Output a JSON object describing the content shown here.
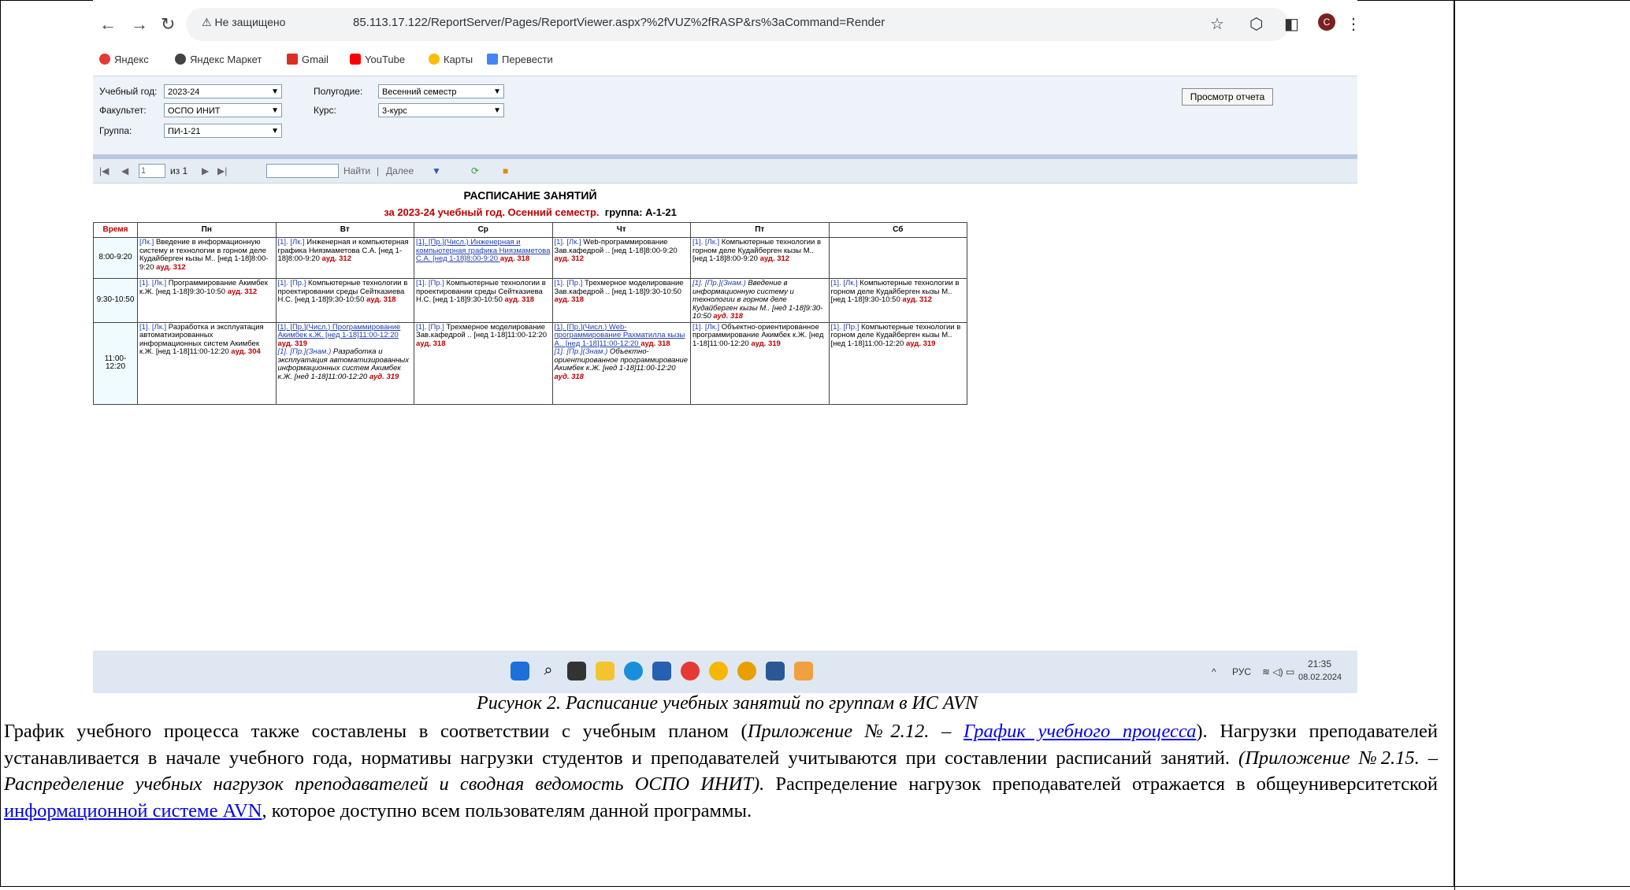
{
  "browser": {
    "security_label": "Не защищено",
    "url": "85.113.17.122/ReportServer/Pages/ReportViewer.aspx?%2fVUZ%2fRASP&rs%3aCommand=Render",
    "avatar_letter": "C",
    "bookmarks": [
      "Яндекс",
      "Яндекс Маркет",
      "Gmail",
      "YouTube",
      "Карты",
      "Перевести"
    ]
  },
  "params": {
    "year_label": "Учебный год:",
    "year_value": "2023-24",
    "faculty_label": "Факультет:",
    "faculty_value": "ОСПО ИНИТ",
    "group_label": "Группа:",
    "group_value": "ПИ-1-21",
    "semester_label": "Полугодие:",
    "semester_value": "Весенний семестр",
    "course_label": "Курс:",
    "course_value": "3-курс",
    "view_button": "Просмотр отчета"
  },
  "toolbar": {
    "page": "1",
    "of_pages": "из 1",
    "find": "Найти",
    "separator": "|",
    "next": "Далее"
  },
  "report": {
    "title": "РАСПИСАНИЕ ЗАНЯТИЙ",
    "subtitle": "за 2023-24 учебный год. Осенний семестр.",
    "group": "группа: А-1-21",
    "headers": [
      "Время",
      "Пн",
      "Вт",
      "Ср",
      "Чт",
      "Пт",
      "Сб"
    ],
    "rows": [
      {
        "time": "8:00-9:20",
        "cells": [
          [
            {
              "tag": "[Лк.]",
              "text": " Введение в информационную систему и технологии в горном деле Кудайберген кызы М.. [нед 1-18]8:00-9:20 ",
              "room": "ауд. 312"
            }
          ],
          [
            {
              "tag": "[1]. [Лк.]",
              "text": " Инженерная и компьютерная графика Ниязмаметова С.А. [нед 1-18]8:00-9:20 ",
              "room": "ауд. 312"
            }
          ],
          [
            {
              "tag": "[1]. [Пр.](Числ.)",
              "text": " Инженерная и компьютерная графика Ниязмаметова С.А. [нед 1-18]8:00-9:20 ",
              "room": "ауд. 318",
              "style": "ul"
            }
          ],
          [
            {
              "tag": "[1]. [Лк.]",
              "text": " Web-программирование Зав.кафедрой .. [нед 1-18]8:00-9:20 ",
              "room": "ауд. 312"
            }
          ],
          [
            {
              "tag": "[1]. [Лк.]",
              "text": " Компьютерные технологии в горном деле Кудайберген кызы М.. [нед 1-18]8:00-9:20 ",
              "room": "ауд. 312"
            }
          ],
          []
        ]
      },
      {
        "time": "9:30-10:50",
        "cells": [
          [
            {
              "tag": "[1]. [Лк.]",
              "text": " Программирование Акимбек к.Ж. [нед 1-18]9:30-10:50 ",
              "room": "ауд. 312"
            }
          ],
          [
            {
              "tag": "[1]. [Пр.]",
              "text": " Компьютерные технологии в проектировании среды Сейтказиева Н.С. [нед 1-18]9:30-10:50 ",
              "room": "ауд. 318"
            }
          ],
          [
            {
              "tag": "[1]. [Пр.]",
              "text": " Компьютерные технологии в проектировании среды Сейтказиева Н.С. [нед 1-18]9:30-10:50 ",
              "room": "ауд. 318"
            }
          ],
          [
            {
              "tag": "[1]. [Пр.]",
              "text": " Трехмерное моделирование Зав.кафедрой .. [нед 1-18]9:30-10:50 ",
              "room": "ауд. 318"
            }
          ],
          [
            {
              "tag": "[1]. [Пр.](Знам.)",
              "text": " Введение в информационную систему и технологии в горном деле Кудайберген кызы М.. [нед 1-18]9:30-10:50 ",
              "room": "ауд. 318",
              "style": "ital"
            }
          ],
          [
            {
              "tag": "[1]. [Лк.]",
              "text": " Компьютерные технологии в горном деле Кудайберген кызы М.. [нед 1-18]9:30-10:50 ",
              "room": "ауд. 312"
            }
          ]
        ]
      },
      {
        "time": "11:00-12:20",
        "cells": [
          [
            {
              "tag": "[1]. [Лк.]",
              "text": " Разработка и эксплуатация автоматизированных информационных систем Акимбек к.Ж. [нед 1-18]11:00-12:20 ",
              "room": "ауд. 304"
            }
          ],
          [
            {
              "tag": "[1]. [Пр.](Числ.)",
              "text": " Программирование Акимбек к.Ж. [нед 1-18]11:00-12:20 ",
              "room": "ауд. 319",
              "style": "ul"
            },
            {
              "tag": "[1]. [Пр.](Знам.)",
              "text": " Разработка и эксплуатация автоматизированных информационных систем Акимбек к.Ж. [нед 1-18]11:00-12:20 ",
              "room": "ауд. 319",
              "style": "ital"
            }
          ],
          [
            {
              "tag": "[1]. [Пр.]",
              "text": " Трехмерное моделирование Зав.кафедрой .. [нед 1-18]11:00-12:20 ",
              "room": "ауд. 318"
            }
          ],
          [
            {
              "tag": "[1]. [Пр.](Числ.)",
              "text": " Web-программирование Рахматилла кызы А.. [нед 1-18]11:00-12:20 ",
              "room": "ауд. 318",
              "style": "ul"
            },
            {
              "tag": "[1]. [Пр.](Знам.)",
              "text": " Объектно-ориентированное программирование Акимбек к.Ж. [нед 1-18]11:00-12:20 ",
              "room": "ауд. 318",
              "style": "ital"
            }
          ],
          [
            {
              "tag": "[1]. [Лк.]",
              "text": " Объектно-ориентированное программирование Акимбек к.Ж. [нед 1-18]11:00-12:20 ",
              "room": "ауд. 319"
            }
          ],
          [
            {
              "tag": "[1]. [Пр.]",
              "text": " Компьютерные технологии в горном деле Кудайберген кызы М.. [нед 1-18]11:00-12:20 ",
              "room": "ауд. 319"
            }
          ]
        ]
      }
    ]
  },
  "taskbar": {
    "lang": "РУС",
    "time": "21:35",
    "date": "08.02.2024"
  },
  "caption": "Рисунок 2. Расписание учебных занятий по группам в ИС AVN",
  "paragraph": {
    "p1": "График учебного процесса также составлены в соответствии с учебным планом (",
    "i1": "Приложение №2.12. – ",
    "link1": "График учебного процесса",
    "p2": "). Нагрузки преподавателей устанавливается в начале учебного года, нормативы нагрузки студентов и преподавателей учитываются при составлении расписаний занятий. ",
    "i2": "(Приложение №2.15. – Распределение учебных нагрузок преподавателей и сводная ведомость ОСПО ИНИТ).",
    "p3": " Распределение нагрузок преподавателей отражается в общеуниверситетской ",
    "link2": "информационной системе AVN",
    "p4": ", которое доступно всем пользователям данной программы."
  }
}
